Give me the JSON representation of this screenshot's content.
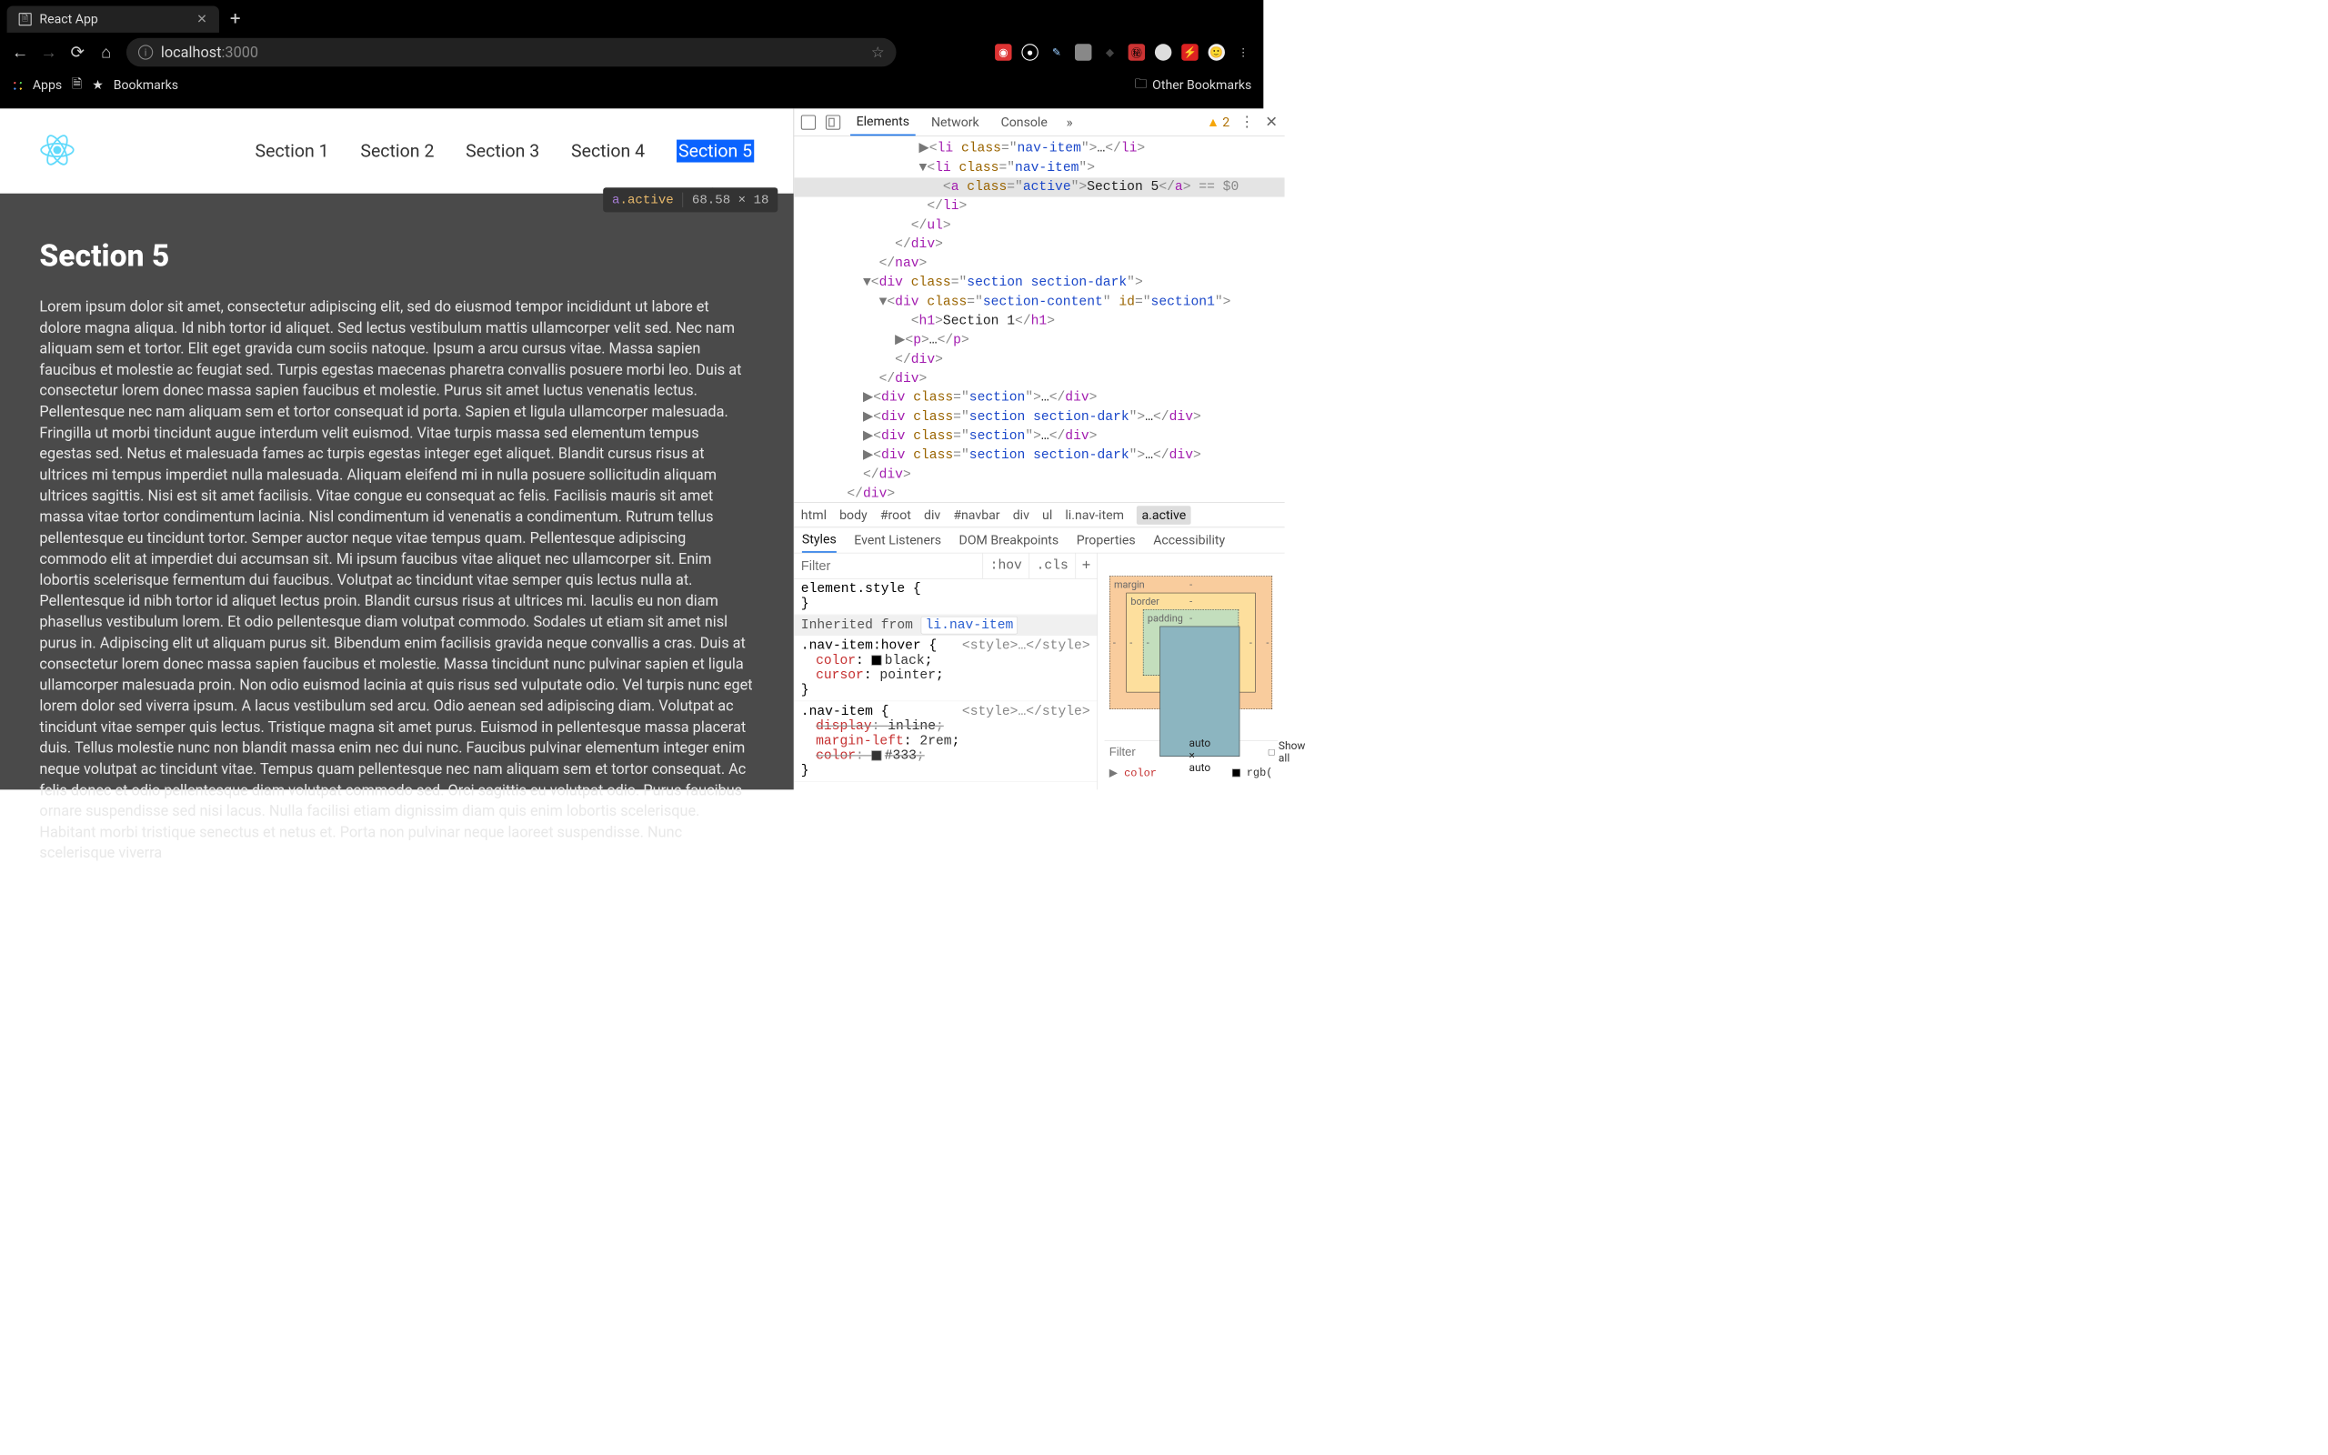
{
  "browser": {
    "tab_title": "React App",
    "url_host": "localhost",
    "url_port": ":3000",
    "apps": "Apps",
    "bookmarks": "Bookmarks",
    "other_bookmarks": "Other Bookmarks"
  },
  "page": {
    "nav": [
      "Section 1",
      "Section 2",
      "Section 3",
      "Section 4",
      "Section 5"
    ],
    "active_nav_index": 4,
    "tooltip_selector_a": "a",
    "tooltip_selector_class": ".active",
    "tooltip_dims": "68.58 × 18",
    "heading": "Section 5",
    "body": "Lorem ipsum dolor sit amet, consectetur adipiscing elit, sed do eiusmod tempor incididunt ut labore et dolore magna aliqua. Id nibh tortor id aliquet. Sed lectus vestibulum mattis ullamcorper velit sed. Nec nam aliquam sem et tortor. Elit eget gravida cum sociis natoque. Ipsum a arcu cursus vitae. Massa sapien faucibus et molestie ac feugiat sed. Turpis egestas maecenas pharetra convallis posuere morbi leo. Duis at consectetur lorem donec massa sapien faucibus et molestie. Purus sit amet luctus venenatis lectus. Pellentesque nec nam aliquam sem et tortor consequat id porta. Sapien et ligula ullamcorper malesuada. Fringilla ut morbi tincidunt augue interdum velit euismod. Vitae turpis massa sed elementum tempus egestas sed. Netus et malesuada fames ac turpis egestas integer eget aliquet. Blandit cursus risus at ultrices mi tempus imperdiet nulla malesuada. Aliquam eleifend mi in nulla posuere sollicitudin aliquam ultrices sagittis. Nisi est sit amet facilisis. Vitae congue eu consequat ac felis. Facilisis mauris sit amet massa vitae tortor condimentum lacinia. Nisl condimentum id venenatis a condimentum. Rutrum tellus pellentesque eu tincidunt tortor. Semper auctor neque vitae tempus quam. Pellentesque adipiscing commodo elit at imperdiet dui accumsan sit. Mi ipsum faucibus vitae aliquet nec ullamcorper sit. Enim lobortis scelerisque fermentum dui faucibus. Volutpat ac tincidunt vitae semper quis lectus nulla at. Pellentesque id nibh tortor id aliquet lectus proin. Blandit cursus risus at ultrices mi. Iaculis eu non diam phasellus vestibulum lorem. Et odio pellentesque diam volutpat commodo. Sodales ut etiam sit amet nisl purus in. Adipiscing elit ut aliquam purus sit. Bibendum enim facilisis gravida neque convallis a cras. Duis at consectetur lorem donec massa sapien faucibus et molestie. Massa tincidunt nunc pulvinar sapien et ligula ullamcorper malesuada proin. Non odio euismod lacinia at quis risus sed vulputate odio. Vel turpis nunc eget lorem dolor sed viverra ipsum. A lacus vestibulum sed arcu. Odio aenean sed adipiscing diam. Volutpat ac tincidunt vitae semper quis lectus. Tristique magna sit amet purus. Euismod in pellentesque massa placerat duis. Tellus molestie nunc non blandit massa enim nec dui nunc. Faucibus pulvinar elementum integer enim neque volutpat ac tincidunt vitae. Tempus quam pellentesque nec nam aliquam sem et tortor consequat. Ac felis donec et odio pellentesque diam volutpat commodo sed. Orci sagittis eu volutpat odio. Purus faucibus ornare suspendisse sed nisi lacus. Nulla facilisi etiam dignissim diam quis enim lobortis scelerisque. Habitant morbi tristique senectus et netus et. Porta non pulvinar neque laoreet suspendisse. Nunc scelerisque viverra"
  },
  "devtools": {
    "tabs": [
      "Elements",
      "Network",
      "Console"
    ],
    "warning_count": "2",
    "crumbs": [
      "html",
      "body",
      "#root",
      "div",
      "#navbar",
      "div",
      "ul",
      "li.nav-item",
      "a.active"
    ],
    "styles_tabs": [
      "Styles",
      "Event Listeners",
      "DOM Breakpoints",
      "Properties",
      "Accessibility"
    ],
    "filter_placeholder": "Filter",
    "hov": ":hov",
    "cls": ".cls",
    "element_style": "element.style",
    "inherited_from": "Inherited from",
    "inherited_link": "li.nav-item",
    "rule1_selector": ".nav-item:hover",
    "rule1_source": "<style>…</style>",
    "rule1_props": [
      {
        "name": "color",
        "value": "black",
        "swatch": "#000"
      },
      {
        "name": "cursor",
        "value": "pointer"
      }
    ],
    "rule2_selector": ".nav-item",
    "rule2_source": "<style>…</style>",
    "rule2_props": [
      {
        "name": "display",
        "value": "inline",
        "strike": true
      },
      {
        "name": "margin-left",
        "value": "2rem"
      },
      {
        "name": "color",
        "value": "#333",
        "swatch": "#333",
        "strike": true
      }
    ],
    "box_model": {
      "margin": "margin",
      "border": "border",
      "padding": "padding",
      "content": "auto × auto"
    },
    "filter2_placeholder": "Filter",
    "show_all": "Show all",
    "computed_color_label": "color",
    "computed_color_prefix": "rgb(",
    "tree": {
      "li_cut": "<li class=\"nav-item\">…</li>",
      "li_open": "<li class=\"nav-item\">",
      "a_open_pre": "<a class=\"",
      "a_open_cls": "active",
      "a_open_post": "\">",
      "a_text": "Section 5",
      "a_close": "</a>",
      "sel_post": " == $0",
      "li_close": "</li>",
      "ul_close": "</ul>",
      "div_close": "</div>",
      "nav_close": "</nav>",
      "sec_dark": "section section-dark",
      "sec": "section",
      "sec_content": "section-content",
      "id_section1": "section1",
      "h1_open": "<h1>",
      "h1_text": "Section 1",
      "h1_close": "</h1>",
      "p": "<p>…</p>"
    }
  }
}
